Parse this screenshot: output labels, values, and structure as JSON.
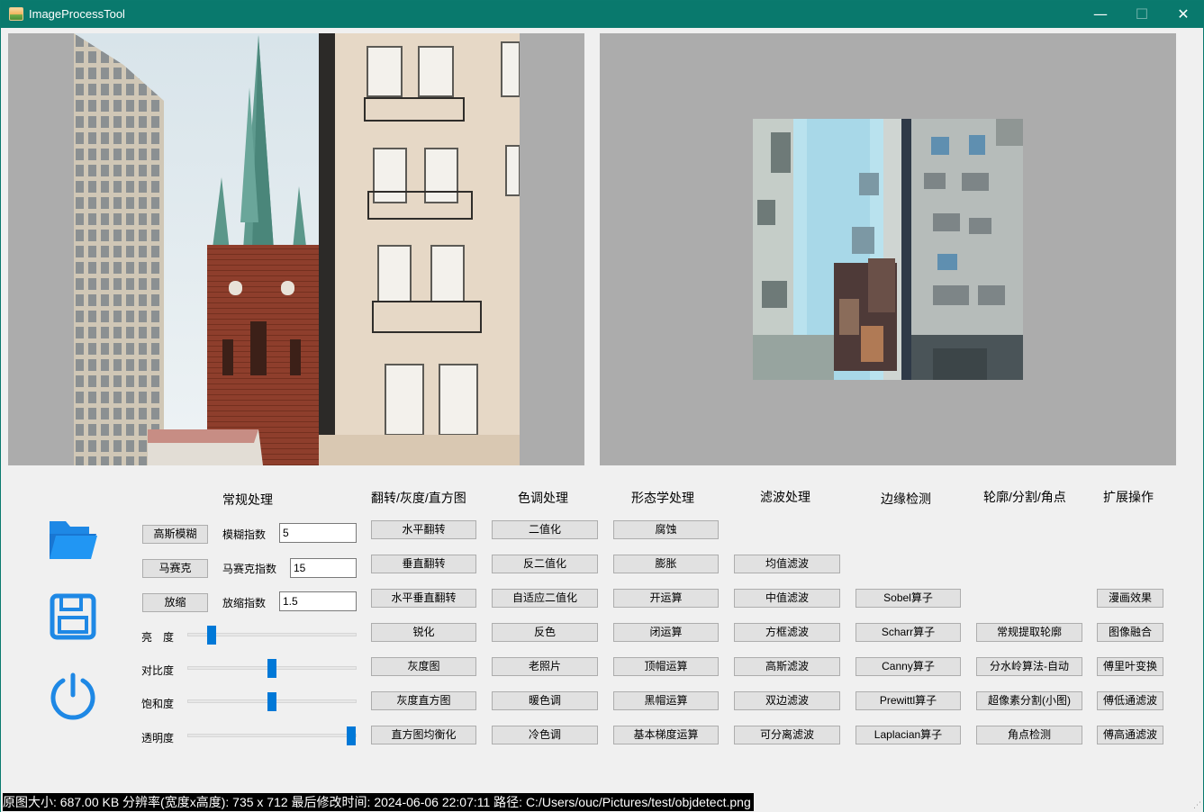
{
  "window": {
    "title": "ImageProcessTool",
    "controls": {
      "minimize": "—",
      "maximize": "☐",
      "close": "✕"
    }
  },
  "colors": {
    "titlebar": "#09796d",
    "accent": "#0078d7",
    "panel": "#acacac"
  },
  "icons": [
    "app-icon",
    "folder-open-icon",
    "save-icon",
    "power-icon"
  ],
  "sections": {
    "general": "常规处理",
    "flip_gray_hist": "翻转/灰度/直方图",
    "tone": "色调处理",
    "morphology": "形态学处理",
    "filter": "滤波处理",
    "edge": "边缘检测",
    "contour": "轮廓/分割/角点",
    "extend": "扩展操作"
  },
  "general": {
    "blur_button": "高斯模糊",
    "blur_label": "模糊指数",
    "blur_value": "5",
    "mosaic_button": "马赛克",
    "mosaic_label": "马赛克指数",
    "mosaic_value": "15",
    "scale_button": "放缩",
    "scale_label": "放缩指数",
    "scale_value": "1.5"
  },
  "sliders": {
    "brightness": {
      "label": "亮　度",
      "level": 0.12
    },
    "contrast": {
      "label": "对比度",
      "level": 0.5
    },
    "saturation": {
      "label": "饱和度",
      "level": 0.5
    },
    "opacity": {
      "label": "透明度",
      "level": 1.0
    }
  },
  "flip_gray_hist": {
    "b1": "水平翻转",
    "b2": "垂直翻转",
    "b3": "水平垂直翻转",
    "b4": "锐化",
    "b5": "灰度图",
    "b6": "灰度直方图",
    "b7": "直方图均衡化"
  },
  "tone": {
    "b1": "二值化",
    "b2": "反二值化",
    "b3": "自适应二值化",
    "b4": "反色",
    "b5": "老照片",
    "b6": "暖色调",
    "b7": "冷色调"
  },
  "morphology": {
    "b1": "腐蚀",
    "b2": "膨胀",
    "b3": "开运算",
    "b4": "闭运算",
    "b5": "顶帽运算",
    "b6": "黑帽运算",
    "b7": "基本梯度运算"
  },
  "filter": {
    "b1": "均值滤波",
    "b2": "中值滤波",
    "b3": "方框滤波",
    "b4": "高斯滤波",
    "b5": "双边滤波",
    "b6": "可分离滤波"
  },
  "edge": {
    "b1": "Sobel算子",
    "b2": "Scharr算子",
    "b3": "Canny算子",
    "b4": "Prewittl算子",
    "b5": "Laplacian算子"
  },
  "contour": {
    "b1": "常规提取轮廓",
    "b2": "分水岭算法-自动",
    "b3": "超像素分割(小图)",
    "b4": "角点检测"
  },
  "extend": {
    "b1": "漫画效果",
    "b2": "图像融合",
    "b3": "傅里叶变换",
    "b4": "傅低通滤波",
    "b5": "傅高通滤波"
  },
  "status": "原图大小: 687.00 KB    分辨率(宽度x高度): 735 x 712    最后修改时间: 2024-06-06 22:07:11    路径: C:/Users/ouc/Pictures/test/objdetect.png"
}
